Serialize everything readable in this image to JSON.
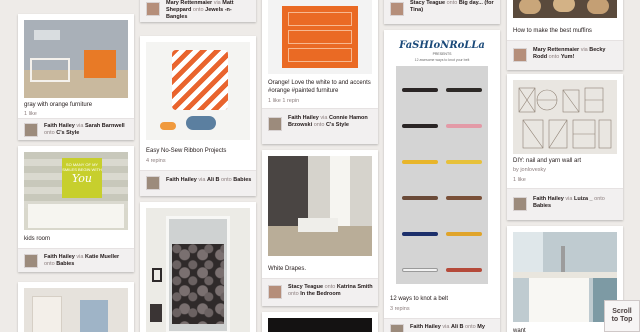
{
  "pins": [
    {
      "key": "gray-room",
      "description": "gray with orange furniture",
      "stats": "1 like",
      "user": "Faith Hailey",
      "via_word": "via",
      "source_user": "Sarah Barnwell",
      "onto_word": "onto",
      "board": "C's Style"
    },
    {
      "key": "you-art",
      "description": "kids room",
      "stats": "",
      "user": "Faith Hailey",
      "via_word": "via",
      "source_user": "Katie Mueller",
      "onto_word": "onto",
      "board": "Babies",
      "art_text": "SO MANY OF MY SMILES BEGIN WITH",
      "art_word": "You"
    },
    {
      "key": "bedroom-bottom",
      "description": "",
      "stats": "",
      "user": "",
      "via_word": "",
      "source_user": "",
      "onto_word": "",
      "board": ""
    },
    {
      "key": "jewels-top",
      "description": "",
      "stats": "",
      "user": "Mary Rettenmaier",
      "via_word": "via",
      "source_user": "Matt Sheppard",
      "onto_word": "onto",
      "board": "Jewels -n- Bangles"
    },
    {
      "key": "lamp",
      "description": "Easy No-Sew Ribbon Projects",
      "stats": "4 repins",
      "user": "Faith Hailey",
      "via_word": "via",
      "source_user": "Ali B",
      "onto_word": "onto",
      "board": "Babies"
    },
    {
      "key": "window",
      "description": "",
      "stats": "",
      "user": "",
      "via_word": "",
      "source_user": "",
      "onto_word": "",
      "board": ""
    },
    {
      "key": "dresser",
      "description": "Orange! Love the white to and accents #orange #painted furniture",
      "stats": "1 like   1 repin",
      "user": "Faith Hailey",
      "via_word": "via",
      "source_user": "Connie Hamon Brzowski",
      "onto_word": "onto",
      "board": "C's Style"
    },
    {
      "key": "dining",
      "description": "White Drapes.",
      "stats": "",
      "user": "Stacy Teague",
      "via_word": "onto",
      "source_user": "Katrina Smith",
      "onto_word": "onto",
      "board": "In the Bedroom"
    },
    {
      "key": "dark-bottom",
      "description": "",
      "stats": "",
      "user": "",
      "via_word": "",
      "source_user": "",
      "onto_word": "",
      "board": ""
    },
    {
      "key": "big-day-top",
      "description": "",
      "stats": "",
      "user": "Stacy Teague",
      "via_word": "onto",
      "source_user": "Big day...",
      "onto_word": "",
      "board": "(for Tina)"
    },
    {
      "key": "belts",
      "description": "12 ways to knot a belt",
      "stats": "3 repins",
      "user": "Faith Hailey",
      "via_word": "via",
      "source_user": "Ali B",
      "onto_word": "onto",
      "board": "My"
    },
    {
      "key": "muffins",
      "description": "How to make the best muffins",
      "stats": "",
      "user": "Mary Rettenmaier",
      "via_word": "via",
      "source_user": "Becky Rodd",
      "onto_word": "onto",
      "board": "Yum!"
    },
    {
      "key": "home",
      "description": "DIY: nail and yarn wall art",
      "stats": "1 like",
      "user": "Faith Hailey",
      "via_word": "via",
      "source_user": "Luiza _",
      "onto_word": "onto",
      "board": "Babies",
      "by_text": "by jonlovesky"
    },
    {
      "key": "kitchen",
      "description": "want",
      "stats": "",
      "user": "",
      "via_word": "",
      "source_user": "",
      "onto_word": "",
      "board": ""
    }
  ],
  "belts_header": {
    "title": "FaSHIoNRoLLa",
    "subtitle": "PRESENTS",
    "caption": "12 awesome ways to knot your belt"
  },
  "scroll_top": {
    "line1": "Scroll",
    "line2": "to Top"
  }
}
